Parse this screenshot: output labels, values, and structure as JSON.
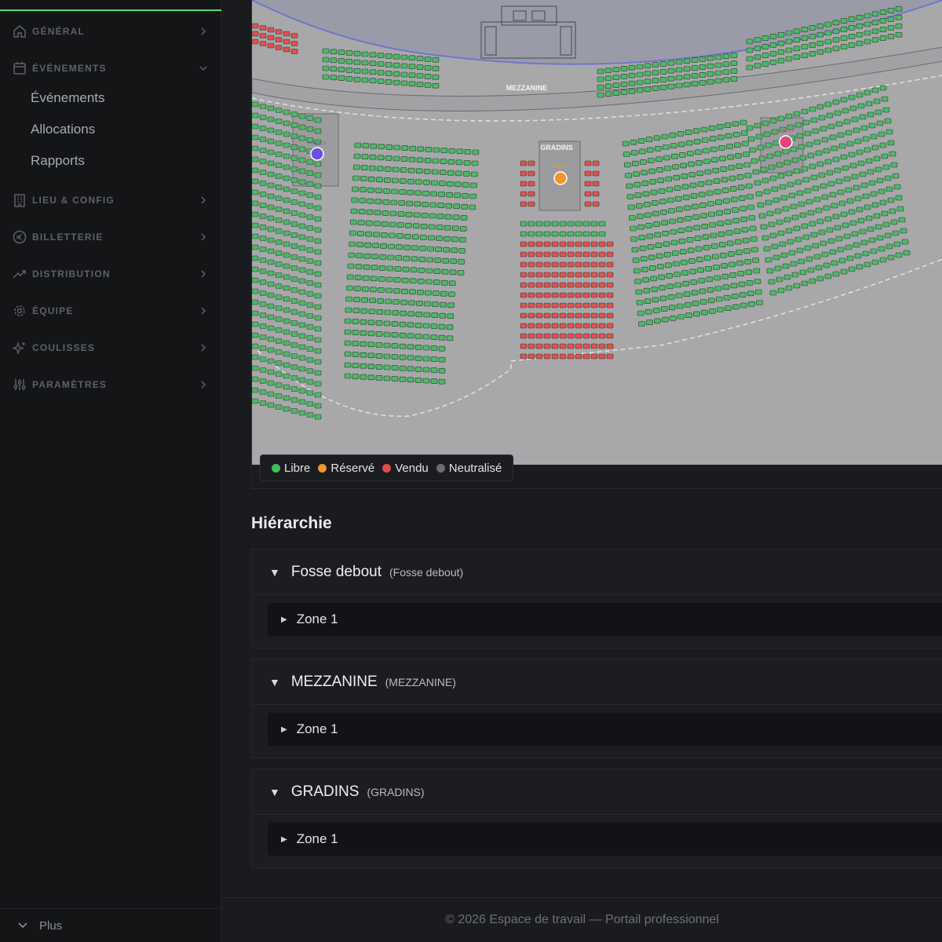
{
  "sidebar": {
    "sections": [
      {
        "label": "GÉNÉRAL",
        "icon": "home-icon"
      },
      {
        "label": "ÉVÉNEMENTS",
        "icon": "calendar-icon"
      },
      {
        "label": "LIEU & CONFIG",
        "icon": "building-icon"
      },
      {
        "label": "BILLETTERIE",
        "icon": "euro-icon"
      },
      {
        "label": "DISTRIBUTION",
        "icon": "trending-up-icon"
      },
      {
        "label": "ÉQUIPE",
        "icon": "gear-icon"
      },
      {
        "label": "COULISSES",
        "icon": "sparkles-icon"
      },
      {
        "label": "PARAMÈTRES",
        "icon": "sliders-icon"
      }
    ],
    "events_items": [
      "Événements",
      "Allocations",
      "Rapports"
    ],
    "more_label": "Plus"
  },
  "map": {
    "labels": {
      "mezzanine": "MEZZANINE",
      "gradins": "GRADINS"
    },
    "markers": [
      {
        "name": "PORTE_D",
        "color": "#6c4ee0"
      },
      {
        "name": "PORTE_G",
        "color": "#f0962a"
      },
      {
        "name": "PORTE_F",
        "color": "#e0467c"
      }
    ],
    "seat_colors": {
      "libre": "#4cb968",
      "reserve": "#f0962a",
      "vendu": "#e25050",
      "neutralise": "#6b6d73"
    }
  },
  "legend": [
    {
      "label": "Libre",
      "color": "#3fbf5c"
    },
    {
      "label": "Réservé",
      "color": "#f0962a"
    },
    {
      "label": "Vendu",
      "color": "#e24a4a"
    },
    {
      "label": "Neutralisé",
      "color": "#6b6d73"
    }
  ],
  "hierarchy": {
    "title": "Hiérarchie",
    "zones": [
      {
        "name": "Fosse debout",
        "code": "(Fosse debout)",
        "children": [
          "Zone 1"
        ]
      },
      {
        "name": "MEZZANINE",
        "code": "(MEZZANINE)",
        "children": [
          "Zone 1"
        ]
      },
      {
        "name": "GRADINS",
        "code": "(GRADINS)",
        "children": [
          "Zone 1"
        ]
      }
    ]
  },
  "footer": {
    "text": "© 2026 Espace de travail — Portail professionnel"
  },
  "colors": {
    "accent": "#4ade80",
    "sidebar_bg": "#141517",
    "main_bg": "#1a1b1e"
  }
}
